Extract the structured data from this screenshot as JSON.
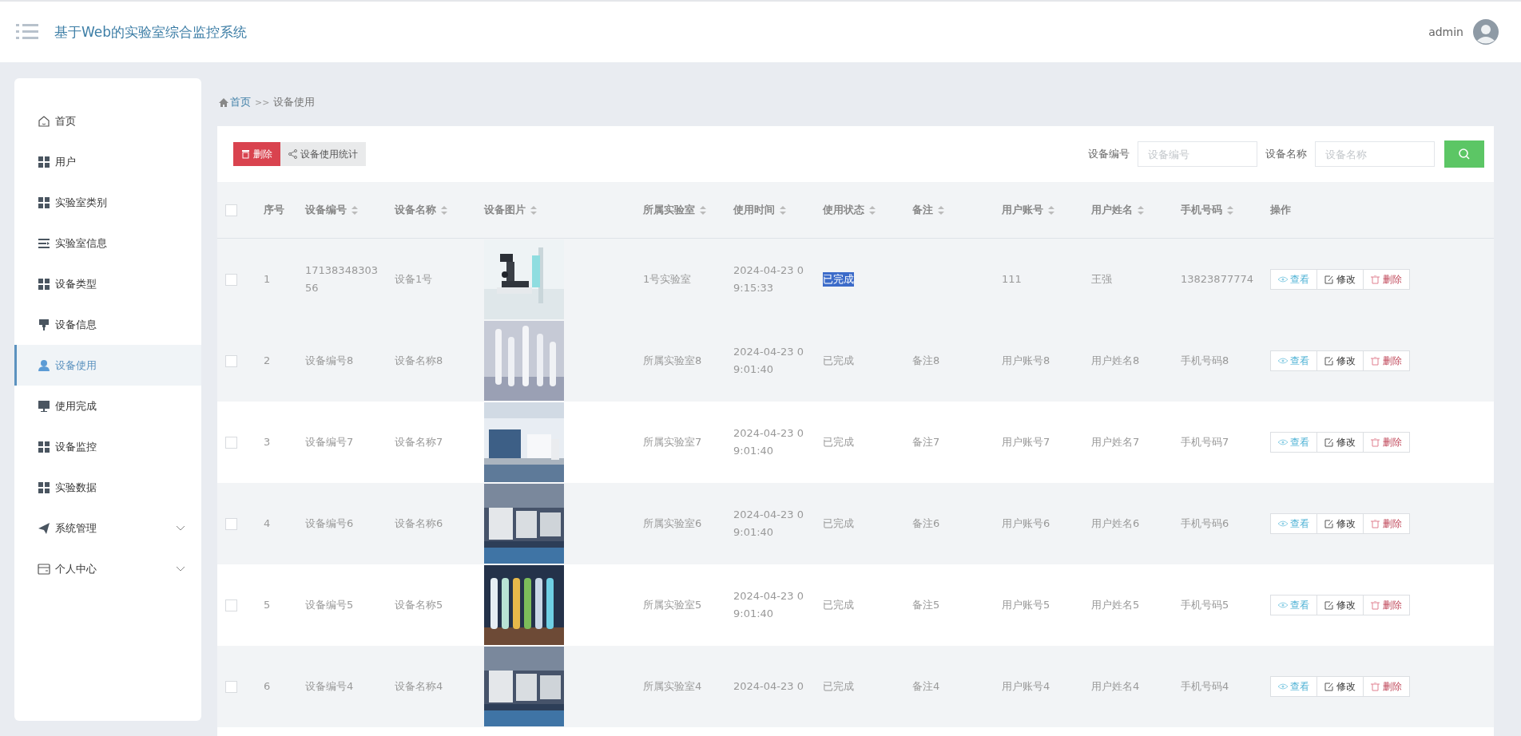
{
  "header": {
    "title": "基于Web的实验室综合监控系统",
    "user": "admin"
  },
  "sidebar": {
    "items": [
      {
        "label": "首页",
        "kind": "link",
        "selected": false
      },
      {
        "label": "用户",
        "kind": "link",
        "selected": false
      },
      {
        "label": "实验室类别",
        "kind": "link",
        "selected": false
      },
      {
        "label": "实验室信息",
        "kind": "link",
        "selected": false
      },
      {
        "label": "设备类型",
        "kind": "link",
        "selected": false
      },
      {
        "label": "设备信息",
        "kind": "link",
        "selected": false
      },
      {
        "label": "设备使用",
        "kind": "link",
        "selected": true
      },
      {
        "label": "使用完成",
        "kind": "link",
        "selected": false
      },
      {
        "label": "设备监控",
        "kind": "link",
        "selected": false
      },
      {
        "label": "实验数据",
        "kind": "link",
        "selected": false
      },
      {
        "label": "系统管理",
        "kind": "group",
        "selected": false,
        "expanded": false
      },
      {
        "label": "个人中心",
        "kind": "group",
        "selected": false,
        "expanded": false
      }
    ]
  },
  "breadcrumb": {
    "home": "首页",
    "separator": ">>",
    "current": "设备使用"
  },
  "toolbar": {
    "buttons": [
      {
        "label": "删除",
        "kind": "danger"
      },
      {
        "label": "设备使用统计",
        "kind": "chart"
      }
    ]
  },
  "search": {
    "fields": [
      {
        "label": "设备编号",
        "placeholder": "设备编号"
      },
      {
        "label": "设备名称",
        "placeholder": "设备名称"
      }
    ]
  },
  "table": {
    "select_all_checked": false,
    "columns": [
      {
        "label": "序号",
        "sortable": false
      },
      {
        "label": "设备编号",
        "sortable": true
      },
      {
        "label": "设备名称",
        "sortable": true
      },
      {
        "label": "设备图片",
        "sortable": true
      },
      {
        "label": "所属实验室",
        "sortable": true
      },
      {
        "label": "使用时间",
        "sortable": true
      },
      {
        "label": "使用状态",
        "sortable": true
      },
      {
        "label": "备注",
        "sortable": true
      },
      {
        "label": "用户账号",
        "sortable": true
      },
      {
        "label": "用户姓名",
        "sortable": true
      },
      {
        "label": "手机号码",
        "sortable": true
      },
      {
        "label": "操作",
        "sortable": false
      }
    ],
    "rows": [
      {
        "checked": false,
        "striped": true,
        "index": "1",
        "device_no": "1713834830356",
        "device_name": "设备1号",
        "lab": "1号实验室",
        "time": "2024-04-23 09:15:33",
        "status": "已完成",
        "status_highlighted": true,
        "account": "111",
        "user_name": "王强",
        "phone": "13823877774",
        "actions": [
          "查看",
          "修改",
          "删除"
        ]
      },
      {
        "checked": false,
        "striped": true,
        "index": "2",
        "device_no": "设备编号8",
        "device_name": "设备名称8",
        "lab": "所属实验室8",
        "time": "2024-04-23 09:01:40",
        "status": "已完成",
        "status_highlighted": false,
        "remark": "备注8",
        "account": "用户账号8",
        "user_name": "用户姓名8",
        "phone": "手机号码8",
        "actions": [
          "查看",
          "修改",
          "删除"
        ]
      },
      {
        "checked": false,
        "striped": false,
        "index": "3",
        "device_no": "设备编号7",
        "device_name": "设备名称7",
        "lab": "所属实验室7",
        "time": "2024-04-23 09:01:40",
        "status": "已完成",
        "status_highlighted": false,
        "remark": "备注7",
        "account": "用户账号7",
        "user_name": "用户姓名7",
        "phone": "手机号码7",
        "actions": [
          "查看",
          "修改",
          "删除"
        ]
      },
      {
        "checked": false,
        "striped": true,
        "index": "4",
        "device_no": "设备编号6",
        "device_name": "设备名称6",
        "lab": "所属实验室6",
        "time": "2024-04-23 09:01:40",
        "status": "已完成",
        "status_highlighted": false,
        "remark": "备注6",
        "account": "用户账号6",
        "user_name": "用户姓名6",
        "phone": "手机号码6",
        "actions": [
          "查看",
          "修改",
          "删除"
        ]
      },
      {
        "checked": false,
        "striped": false,
        "index": "5",
        "device_no": "设备编号5",
        "device_name": "设备名称5",
        "lab": "所属实验室5",
        "time": "2024-04-23 09:01:40",
        "status": "已完成",
        "status_highlighted": false,
        "remark": "备注5",
        "account": "用户账号5",
        "user_name": "用户姓名5",
        "phone": "手机号码5",
        "actions": [
          "查看",
          "修改",
          "删除"
        ]
      },
      {
        "checked": false,
        "striped": true,
        "index": "6",
        "device_no": "设备编号4",
        "device_name": "设备名称4",
        "lab": "所属实验室4",
        "time": "2024-04-23 0",
        "status": "已完成",
        "status_highlighted": false,
        "remark": "备注4",
        "account": "用户账号4",
        "user_name": "用户姓名4",
        "phone": "手机号码4",
        "actions": [
          "查看",
          "修改",
          "删除"
        ]
      }
    ]
  }
}
